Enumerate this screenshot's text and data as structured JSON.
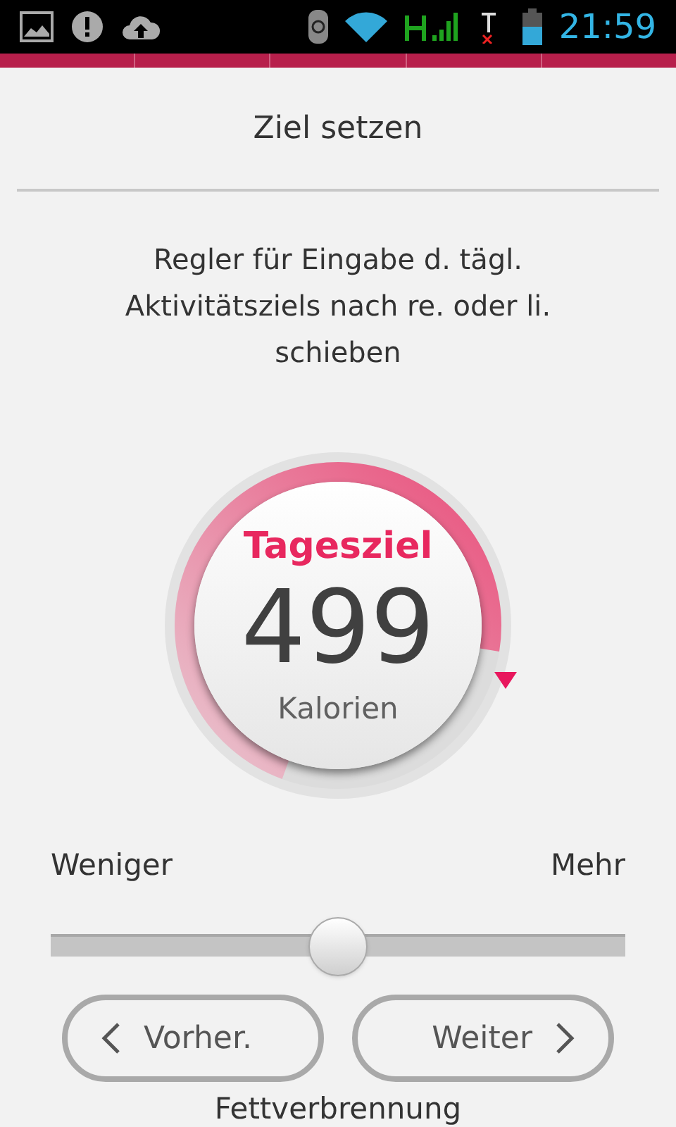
{
  "status_bar": {
    "time": "21:59"
  },
  "title": "Ziel setzen",
  "instruction": "Regler für Eingabe d. tägl. Aktivitätsziels nach re. oder li. schieben",
  "goal": {
    "label": "Tagesziel",
    "value": "499",
    "unit": "Kalorien"
  },
  "slider": {
    "min_label": "Weniger",
    "max_label": "Mehr",
    "level": 0.5
  },
  "summary": {
    "footer": "Fettverbrennung"
  },
  "buttons": [
    {
      "label": "Vorher.",
      "kind": "back"
    },
    {
      "label": "Weiter",
      "kind": "next"
    }
  ]
}
